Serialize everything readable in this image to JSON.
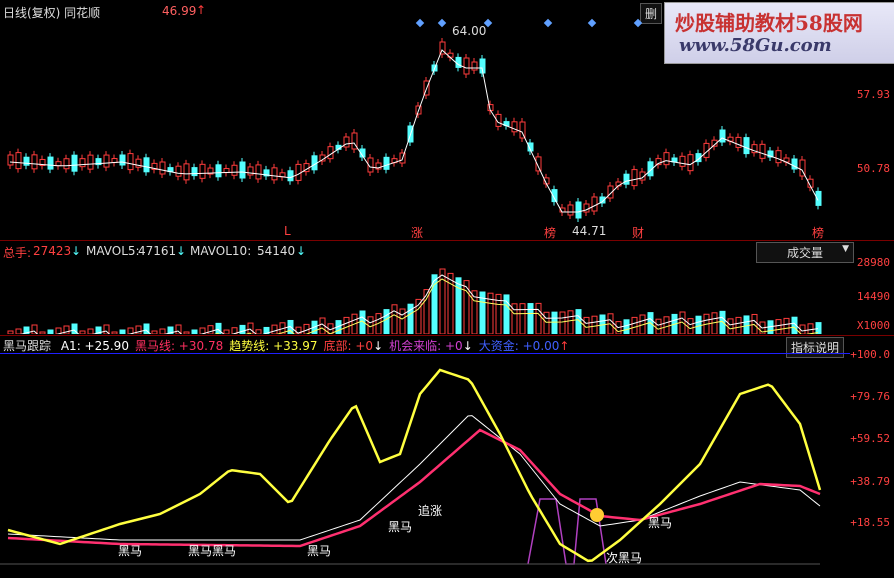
{
  "header": {
    "title": "日线(复权) 同花顺",
    "price": "46.99",
    "delete_label": "删",
    "watermark_line1": "炒股辅助教材58股网",
    "watermark_line2": "www.58Gu.com"
  },
  "price_panel": {
    "axis_labels": [
      "57.93",
      "50.78"
    ],
    "high_label": "64.00",
    "low_label": "44.71",
    "markers": [
      "L",
      "涨",
      "榜",
      "财",
      "榜"
    ]
  },
  "volume_panel": {
    "total_label": "总手:",
    "total_value": "27423",
    "mavol5_label": "MAVOL5:",
    "mavol5_value": "47161",
    "mavol10_label": "MAVOL10:",
    "mavol10_value": "54140",
    "dropdown_label": "成交量",
    "axis_labels": [
      "28980",
      "14490",
      "X1000"
    ]
  },
  "indicator_panel": {
    "name": "黑马跟踪",
    "items": [
      {
        "label": "A1:",
        "value": "+25.90",
        "color": "#ffffff"
      },
      {
        "label": "黑马线:",
        "value": "+30.78",
        "color": "#ff3060"
      },
      {
        "label": "趋势线:",
        "value": "+33.97",
        "color": "#ffff40"
      },
      {
        "label": "底部:",
        "value": "+0",
        "color": "#ff4040"
      },
      {
        "label": "机会来临:",
        "value": "+0",
        "color": "#d040d0"
      },
      {
        "label": "大资金:",
        "value": "+0.00",
        "color": "#4060ff"
      }
    ],
    "help_button": "指标说明",
    "axis_labels": [
      "+100.0",
      "+79.76",
      "+59.52",
      "+38.79",
      "+18.55"
    ],
    "annotations": [
      "黑马",
      "黑马黑马",
      "黑马",
      "黑马",
      "追涨",
      "黑马",
      "次黑马"
    ]
  },
  "colors": {
    "up": "#ff3c3c",
    "down": "#54ffff",
    "axis": "#ff4040",
    "ma": "#ffffff"
  }
}
